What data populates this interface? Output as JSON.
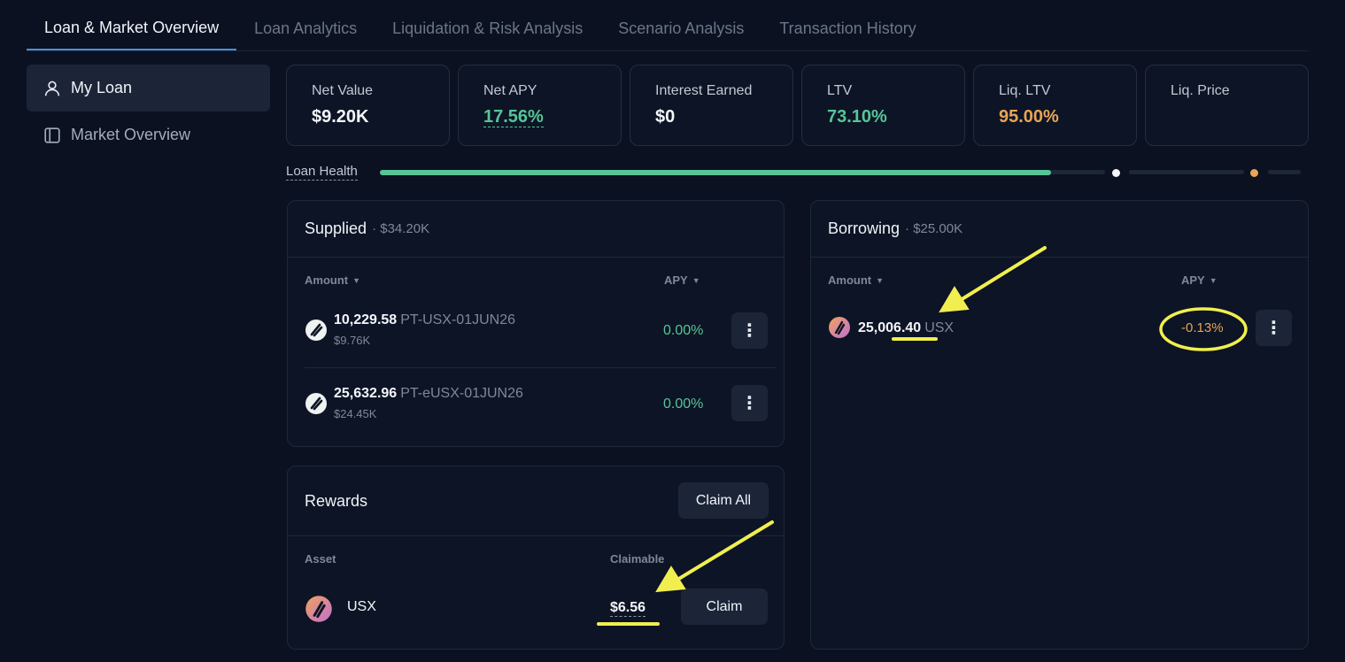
{
  "tabs": [
    {
      "label": "Loan & Market Overview"
    },
    {
      "label": "Loan Analytics"
    },
    {
      "label": "Liquidation & Risk Analysis"
    },
    {
      "label": "Scenario Analysis"
    },
    {
      "label": "Transaction History"
    }
  ],
  "sidebar": {
    "items": [
      {
        "label": "My Loan",
        "icon": "user-icon"
      },
      {
        "label": "Market Overview",
        "icon": "panel-icon"
      }
    ]
  },
  "stats": {
    "net_value": {
      "label": "Net Value",
      "value": "$9.20K"
    },
    "net_apy": {
      "label": "Net APY",
      "value": "17.56%"
    },
    "interest_earned": {
      "label": "Interest Earned",
      "value": "$0"
    },
    "ltv": {
      "label": "LTV",
      "value": "73.10%"
    },
    "liq_ltv": {
      "label": "Liq. LTV",
      "value": "95.00%"
    },
    "liq_price": {
      "label": "Liq. Price",
      "value": ""
    }
  },
  "loan_health": {
    "label": "Loan Health",
    "fill_fraction": 0.731
  },
  "supplied": {
    "title": "Supplied",
    "total": "· $34.20K",
    "col_amount": "Amount",
    "col_apy": "APY",
    "rows": [
      {
        "amount": "10,229.58",
        "token": "PT-USX-01JUN26",
        "usd": "$9.76K",
        "apy": "0.00%"
      },
      {
        "amount": "25,632.96",
        "token": "PT-eUSX-01JUN26",
        "usd": "$24.45K",
        "apy": "0.00%"
      }
    ]
  },
  "borrowing": {
    "title": "Borrowing",
    "total": "· $25.00K",
    "col_amount": "Amount",
    "col_apy": "APY",
    "rows": [
      {
        "amount": "25,006.40",
        "token": "USX",
        "apy": "-0.13%"
      }
    ]
  },
  "rewards": {
    "title": "Rewards",
    "claim_all": "Claim All",
    "col_asset": "Asset",
    "col_claimable": "Claimable",
    "rows": [
      {
        "asset": "USX",
        "claimable": "$6.56",
        "claim": "Claim"
      }
    ]
  },
  "colors": {
    "accent_green": "#56c597",
    "accent_orange": "#e9a455",
    "annotation": "#f1ef4f"
  }
}
